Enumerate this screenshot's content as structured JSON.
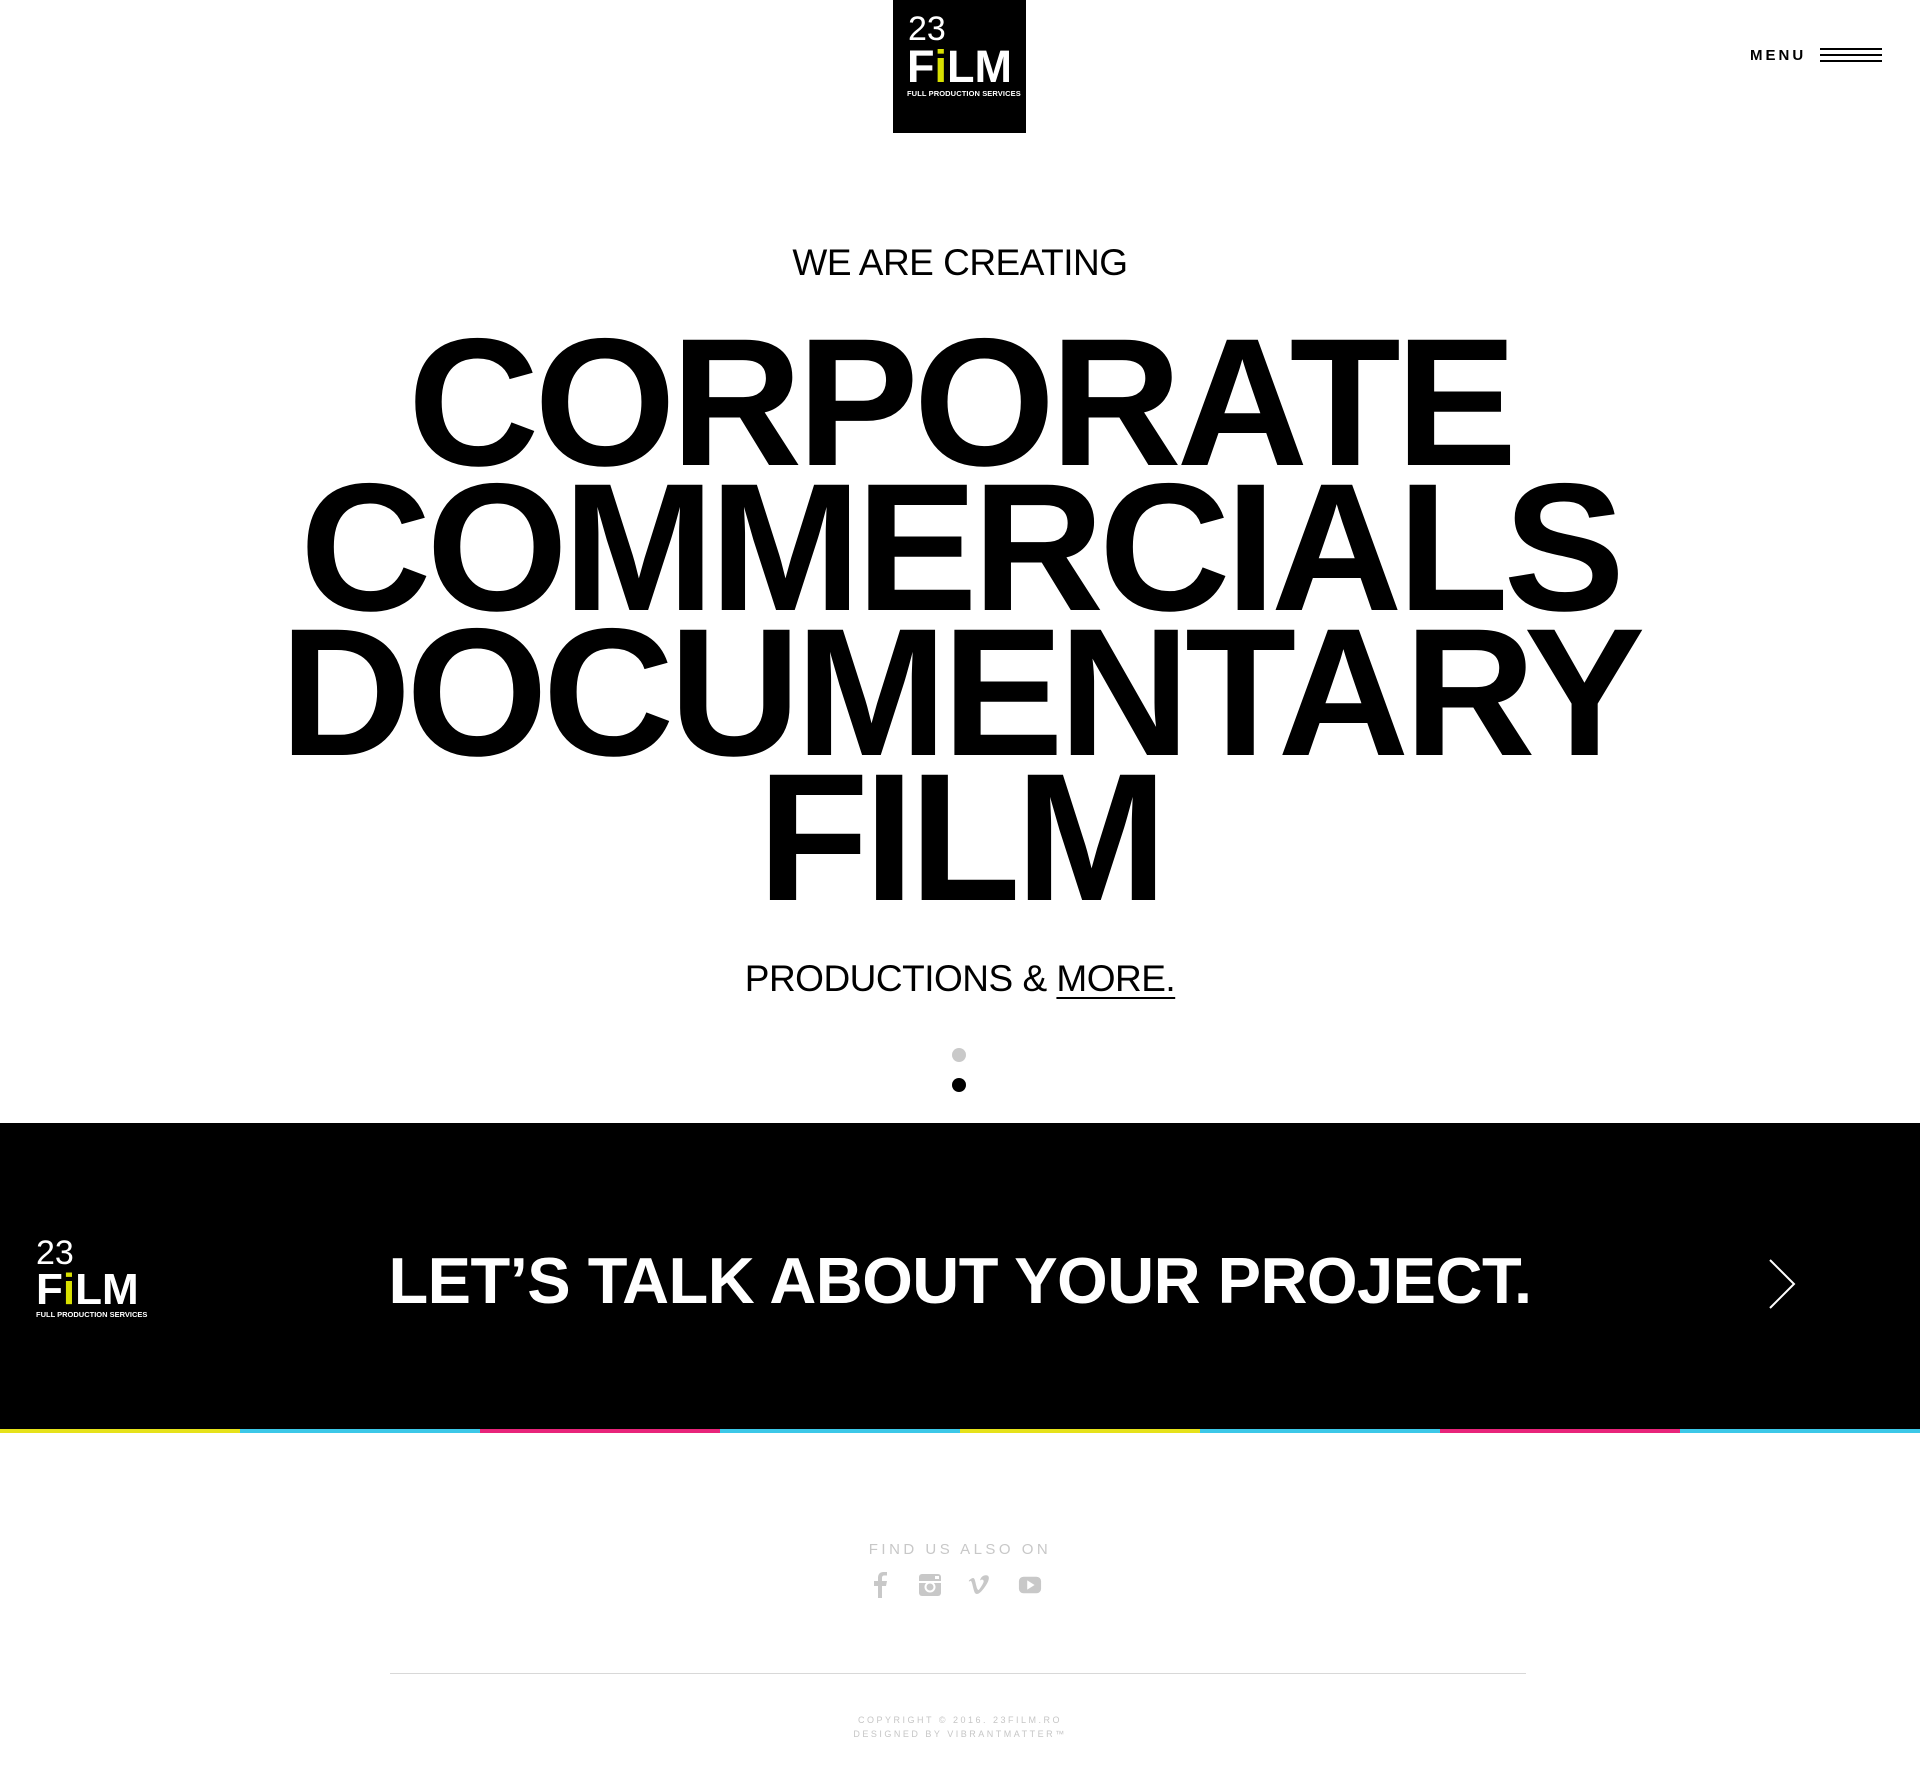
{
  "header": {
    "logo": {
      "number": "23",
      "word_prefix": "F",
      "word_i": "i",
      "word_suffix": "LM",
      "tagline": "FULL PRODUCTION SERVICES"
    },
    "menu_label": "MENU"
  },
  "hero": {
    "intro": "WE ARE CREATING",
    "words": [
      "CORPORATE",
      "COMMERCIALS",
      "DOCUMENTARY",
      "FILM"
    ],
    "outro_prefix": "PRODUCTIONS & ",
    "outro_link": "MORE."
  },
  "cta": {
    "logo": {
      "number": "23",
      "word_prefix": "F",
      "word_i": "i",
      "word_suffix": "LM",
      "tagline": "FULL PRODUCTION SERVICES"
    },
    "title": "LET’S TALK ABOUT YOUR PROJECT.",
    "arrow_icon": "chevron-right-icon"
  },
  "stripe_colors": [
    "#e6e21a",
    "#3cc8e8",
    "#e8247a",
    "#3cc8e8",
    "#e6e21a",
    "#3cc8e8",
    "#e8247a",
    "#3cc8e8"
  ],
  "footer": {
    "find_us": "FIND US ALSO ON",
    "social_icons": [
      "facebook-icon",
      "instagram-icon",
      "vimeo-icon",
      "youtube-icon"
    ],
    "copyright": "COPYRIGHT © 2016. 23FILM.RO",
    "designed_by": "DESIGNED BY VIBRANTMATTER™"
  },
  "colors": {
    "accent_dot": "#d8e000",
    "icon_gray": "#c8c8c8"
  }
}
